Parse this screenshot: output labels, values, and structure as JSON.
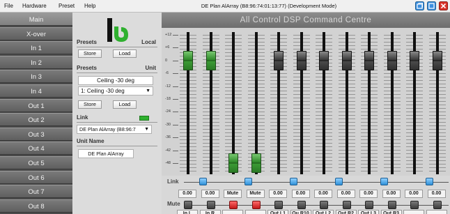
{
  "menubar": {
    "items": [
      "File",
      "Hardware",
      "Preset",
      "Help"
    ],
    "window_title": "DE Plan AlArray (B8:96:74:01:13:77) (Development Mode)"
  },
  "colors": {
    "accent_green": "#2fb02f",
    "link_blue": "#2f90d8",
    "mute_red": "#c41818",
    "close_red": "#d9352b"
  },
  "nav": {
    "items": [
      "Main",
      "X-over",
      "In 1",
      "In 2",
      "In 3",
      "In 4",
      "Out 1",
      "Out 2",
      "Out 3",
      "Out 4",
      "Out 5",
      "Out 6",
      "Out 7",
      "Out 8"
    ],
    "active": "Main"
  },
  "panel": {
    "presets_local": {
      "title": "Presets",
      "scope": "Local",
      "store": "Store",
      "load": "Load"
    },
    "presets_unit": {
      "title": "Presets",
      "scope": "Unit",
      "current": "Ceiling -30 deg",
      "selected": "1: Ceiling -30 deg",
      "store": "Store",
      "load": "Load"
    },
    "link": {
      "title": "Link",
      "selected": "DE Plan AlArray (B8:96:7"
    },
    "unit_name": {
      "title": "Unit Name",
      "value": "DE Plan AlArray"
    }
  },
  "main": {
    "title": "All Control DSP Command Centre",
    "scale": [
      "+12",
      "+6",
      "0",
      "-6",
      "-12",
      "-18",
      "-24",
      "-30",
      "-36",
      "-42",
      "-48"
    ],
    "link_label": "Link",
    "mute_label": "Mute",
    "channels": [
      {
        "name": "In L",
        "value": "0.00",
        "fader_db": 0,
        "color": "green",
        "muted": false,
        "link": false
      },
      {
        "name": "In R",
        "value": "0.00",
        "fader_db": 0,
        "color": "green",
        "muted": false,
        "link": true
      },
      {
        "name": "",
        "value": "Mute",
        "fader_db": -48,
        "color": "green",
        "muted": true,
        "link": false
      },
      {
        "name": "",
        "value": "Mute",
        "fader_db": -48,
        "color": "green",
        "muted": true,
        "link": true
      },
      {
        "name": "Out L1",
        "value": "0.00",
        "fader_db": 0,
        "color": "gray",
        "muted": false,
        "link": false
      },
      {
        "name": "Ou R10",
        "value": "0.00",
        "fader_db": 0,
        "color": "gray",
        "muted": false,
        "link": true
      },
      {
        "name": "Out L2",
        "value": "0.00",
        "fader_db": 0,
        "color": "gray",
        "muted": false,
        "link": false
      },
      {
        "name": "Out R2",
        "value": "0.00",
        "fader_db": 0,
        "color": "gray",
        "muted": false,
        "link": true
      },
      {
        "name": "Out L3",
        "value": "0.00",
        "fader_db": 0,
        "color": "gray",
        "muted": false,
        "link": false
      },
      {
        "name": "Out R3",
        "value": "0.00",
        "fader_db": 0,
        "color": "gray",
        "muted": false,
        "link": true
      },
      {
        "name": "",
        "value": "0.00",
        "fader_db": 0,
        "color": "gray",
        "muted": false,
        "link": false
      },
      {
        "name": "",
        "value": "0.00",
        "fader_db": 0,
        "color": "gray",
        "muted": false,
        "link": true
      }
    ]
  }
}
